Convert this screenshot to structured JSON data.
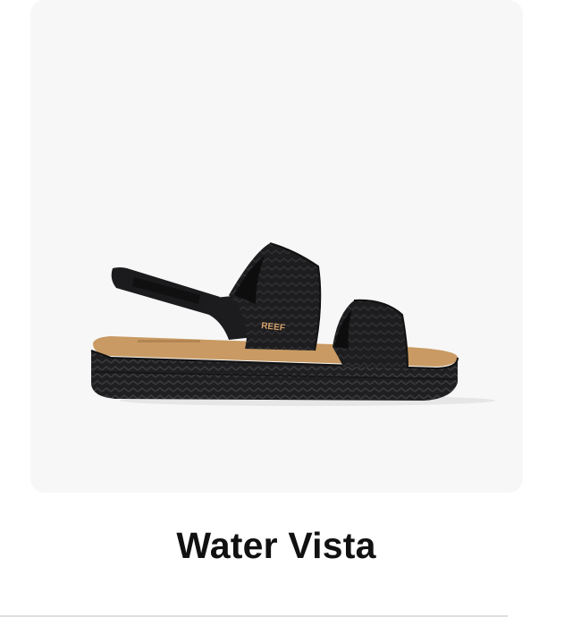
{
  "product": {
    "name": "Water Vista",
    "brand_mark": "REEF",
    "image_icon": "sandal-product-image"
  },
  "colors": {
    "image_background": "#f7f7f7",
    "sandal_body": "#1c1c1e",
    "footbed": "#c99a63",
    "logo": "#d4a169",
    "title_text": "#111111"
  }
}
